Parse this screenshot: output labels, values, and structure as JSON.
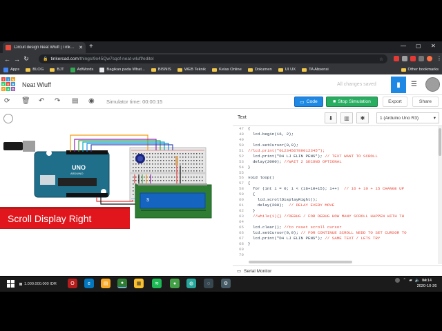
{
  "browser": {
    "tab_title": "Circuit design Neat Wluff | Tinkercad",
    "url_domain": "tinkercad.com",
    "url_path": "/things/9o45Qw7sqof-neat-wluff/editel",
    "bookmarks": [
      {
        "label": "Apps",
        "icon": "apps-icon",
        "color": "#4285f4"
      },
      {
        "label": "BLOG",
        "icon": "folder-icon",
        "color": "#f2c94c"
      },
      {
        "label": "BJT",
        "icon": "folder-icon",
        "color": "#f2c94c"
      },
      {
        "label": "AdWords",
        "icon": "adwords-icon",
        "color": "#34a853"
      },
      {
        "label": "Bagikan pada What...",
        "icon": "site-icon",
        "color": "#e8eaed"
      },
      {
        "label": "BISNIS",
        "icon": "folder-icon",
        "color": "#f2c94c"
      },
      {
        "label": "WEB Teknik",
        "icon": "folder-icon",
        "color": "#f2c94c"
      },
      {
        "label": "Kelas Online",
        "icon": "folder-icon",
        "color": "#f2c94c"
      },
      {
        "label": "Dokumen",
        "icon": "folder-icon",
        "color": "#f2c94c"
      },
      {
        "label": "UI UX",
        "icon": "folder-icon",
        "color": "#f2c94c"
      },
      {
        "label": "TA Absensi",
        "icon": "folder-icon",
        "color": "#f2c94c"
      }
    ],
    "other_bookmarks": "Other bookmarks"
  },
  "app": {
    "project_name": "Neat Wluff",
    "save_status": "All changes saved",
    "logo_letters": [
      "T",
      "I",
      "N",
      "K",
      "E",
      "R",
      "C",
      "A",
      "D"
    ],
    "logo_colors": [
      "#e74c3c",
      "#3498db",
      "#f39c12",
      "#2ecc71",
      "#e74c3c",
      "#3498db",
      "#f39c12",
      "#2ecc71",
      "#9b59b6"
    ]
  },
  "toolbar": {
    "simulator_time": "Simulator time: 00:00:15",
    "code_label": "Code",
    "stop_label": "Stop Simulation",
    "export_label": "Export",
    "share_label": "Share"
  },
  "code_panel": {
    "mode": "Text",
    "device": "1 (Arduino Uno R3)",
    "line_numbers": [
      "47",
      "48",
      "49",
      "50",
      "51",
      "52",
      "53",
      "54",
      "55",
      "56",
      "57",
      "58",
      "59",
      "60",
      "61",
      "62",
      "63",
      "64",
      "65",
      "66",
      "67",
      "68",
      "69",
      "70"
    ],
    "lines": [
      "{",
      "  lcd.begin(16, 2);",
      "",
      "  lcd.setCursor(0,0);",
      "//lcd.print(\"0123456789012345\");",
      "  lcd.print(\"D4 LJ ELIN PENS\"); // TEXT WANT TO SCROLL",
      "  delay(2000); //WAIT 2 SECOND OPTIONAL",
      "}",
      "",
      "void loop()",
      "{",
      "  for (int i = 0; i < (16+10+15); i++)  // 16 + 10 + 15 CHANGE UP",
      "  {",
      "    lcd.scrollDisplayRight();",
      "    delay(200);  // DELAY EVERY MOVE",
      "  }",
      "  //while(1){} //DEBUG / FOR DEBUG HOW MANY SCROLL HAPPEN WITH TH",
      "",
      "  lcd.clear(); //to reset scroll cursor",
      "  lcd.setCursor(0,0); // FOR CONTINUE SCROLL NEDD TO SET CURSOR TO",
      "  lcd.print(\"D4 LJ ELIN PENS\"); // SAME TEXT / LETS TRY",
      "}",
      "",
      ""
    ],
    "serial_monitor": "Serial Monitor"
  },
  "canvas": {
    "banner_text": "Scroll Display Right",
    "lcd_text": "S",
    "arduino_brand": "UNO",
    "arduino_sub": "ARDUINO"
  },
  "taskbar": {
    "ticker": "1.000.000.000 IDR",
    "time": "04:14",
    "date": "2020-10-26"
  }
}
